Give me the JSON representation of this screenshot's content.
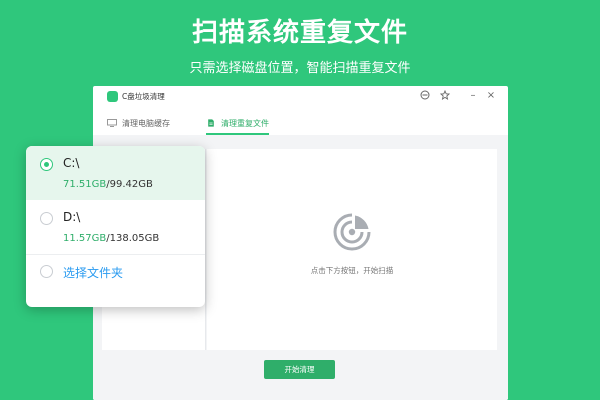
{
  "headline": "扫描系统重复文件",
  "subline": "只需选择磁盘位置，智能扫描重复文件",
  "window": {
    "title": "C盘垃圾清理",
    "controls": [
      "settings-icon",
      "skin-icon",
      "minimize-icon",
      "close-icon"
    ],
    "minimize_glyph": "–",
    "close_glyph": "×",
    "tabs": [
      {
        "label": "清理电脑缓存",
        "icon": "monitor-icon",
        "active": false
      },
      {
        "label": "清理重复文件",
        "icon": "document-icon",
        "active": true
      }
    ],
    "scan_hint": "点击下方按钮，开始扫描",
    "start_button": "开始清理"
  },
  "drives": [
    {
      "name": "C:\\",
      "used": "71.51GB",
      "slash": "/",
      "total": "99.42GB",
      "selected": true
    },
    {
      "name": "D:\\",
      "used": "11.57GB",
      "slash": "/",
      "total": "138.05GB",
      "selected": false
    }
  ],
  "select_folder": "选择文件夹",
  "colors": {
    "brand_green": "#2fc77c",
    "accent_green": "#2fae6a",
    "link_blue": "#2a9bf0"
  }
}
